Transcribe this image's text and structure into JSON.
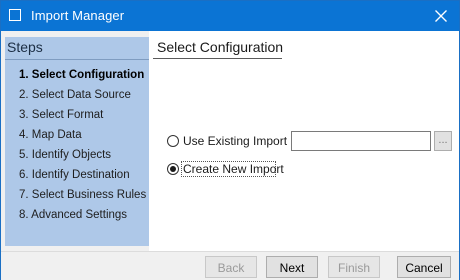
{
  "window": {
    "title": "Import Manager",
    "accent_color": "#0b74d4"
  },
  "steps_panel": {
    "header": "Steps",
    "background_color": "#aec8e8",
    "items": [
      {
        "label": "1. Select Configuration",
        "active": true
      },
      {
        "label": "2. Select Data Source",
        "active": false
      },
      {
        "label": "3. Select Format",
        "active": false
      },
      {
        "label": "4. Map Data",
        "active": false
      },
      {
        "label": "5. Identify Objects",
        "active": false
      },
      {
        "label": "6. Identify Destination",
        "active": false
      },
      {
        "label": "7. Select Business Rules",
        "active": false
      },
      {
        "label": "8. Advanced Settings",
        "active": false
      }
    ]
  },
  "content": {
    "title": "Select Configuration",
    "options": [
      {
        "label": "Use Existing Import",
        "selected": false
      },
      {
        "label": "Create New Import",
        "selected": true
      }
    ],
    "existing_import_value": "",
    "browse_label": "..."
  },
  "footer": {
    "buttons": [
      {
        "label": "Back",
        "enabled": false
      },
      {
        "label": "Next",
        "enabled": true
      },
      {
        "label": "Finish",
        "enabled": false
      },
      {
        "label": "Cancel",
        "enabled": true
      }
    ]
  }
}
